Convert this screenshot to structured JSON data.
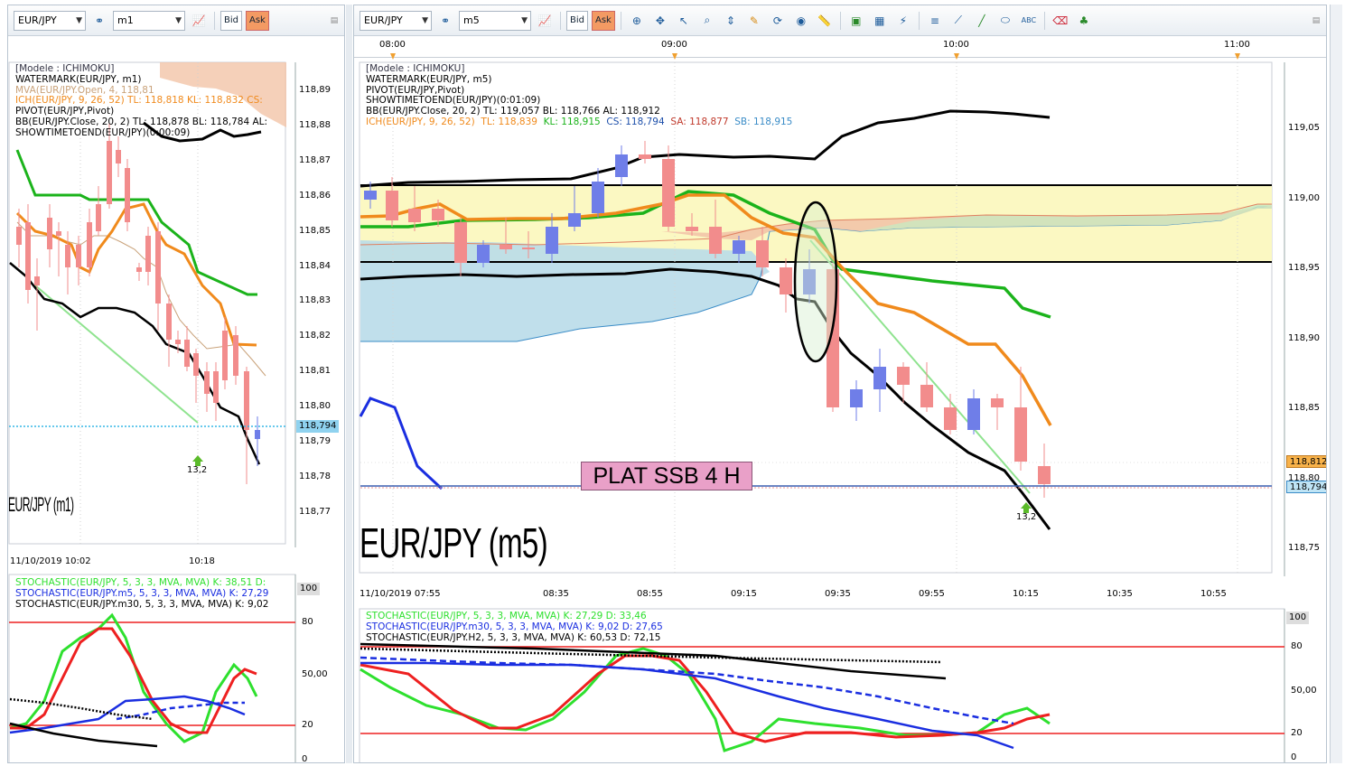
{
  "left": {
    "symbol": "EUR/JPY",
    "timeframe": "m1",
    "bid_label": "Bid",
    "ask_label": "Ask",
    "legend": [
      "[Modele : ICHIMOKU]",
      "WATERMARK(EUR/JPY, m1)",
      "MVA(EUR/JPY.Open, 4, 118,81",
      "ICH(EUR/JPY, 9, 26, 52)  TL: 118,818  KL: 118,832  CS:",
      "PIVOT(EUR/JPY,Pivot)",
      "BB(EUR/JPY.Close, 20, 2)  TL: 118,878  BL: 118,784  AL:",
      "SHOWTIMETOEND(EUR/JPY)(0:00:09)"
    ],
    "price_labels": [
      "118,89",
      "118,88",
      "118,87",
      "118,86",
      "118,85",
      "118,84",
      "118,83",
      "118,82",
      "118,81",
      "118,80",
      "118,79",
      "118,78",
      "118,77"
    ],
    "price_tag": "118,794",
    "watermark": "EUR/JPY (m1)",
    "arrow_label": "13,2",
    "time_labels": [
      "11/10/2019 10:02",
      "10:18"
    ],
    "stoch_legend": [
      "STOCHASTIC(EUR/JPY, 5, 3, 3, MVA, MVA)  K: 38,51  D:",
      "STOCHASTIC(EUR/JPY.m5, 5, 3, 3, MVA, MVA)  K: 27,29",
      "STOCHASTIC(EUR/JPY.m30, 5, 3, 3, MVA, MVA)  K: 9,02"
    ],
    "stoch_labels": [
      "100",
      "80",
      "50,00",
      "20",
      "0"
    ]
  },
  "right": {
    "symbol": "EUR/JPY",
    "timeframe": "m5",
    "bid_label": "Bid",
    "ask_label": "Ask",
    "top_times": [
      "08:00",
      "09:00",
      "10:00",
      "11:00"
    ],
    "legend": [
      "[Modele : ICHIMOKU]",
      "WATERMARK(EUR/JPY, m5)",
      "PIVOT(EUR/JPY,Pivot)",
      "SHOWTIMETOEND(EUR/JPY)(0:01:09)",
      "BB(EUR/JPY.Close, 20, 2)  TL: 119,057  BL: 118,766  AL: 118,912"
    ],
    "ich_legend": {
      "head": "ICH(EUR/JPY, 9, 26, 52)",
      "tl": "TL: 118,839",
      "kl": "KL: 118,915",
      "cs": "CS: 118,794",
      "sa": "SA: 118,877",
      "sb": "SB: 118,915"
    },
    "price_labels": [
      "119,05",
      "119,00",
      "118,95",
      "118,90",
      "118,85",
      "118,80",
      "118,75"
    ],
    "price_tag_orange": "118,812",
    "price_tag_blue": "118,794",
    "watermark": "EUR/JPY (m5)",
    "annotation": "PLAT SSB 4 H",
    "arrow_label": "13,2",
    "time_labels": [
      "11/10/2019 07:55",
      "08:35",
      "08:55",
      "09:15",
      "09:35",
      "09:55",
      "10:15",
      "10:35",
      "10:55"
    ],
    "stoch_legend": [
      "STOCHASTIC(EUR/JPY, 5, 3, 3, MVA, MVA)  K: 27,29  D: 33,46",
      "STOCHASTIC(EUR/JPY.m30, 5, 3, 3, MVA, MVA)  K: 9,02  D: 27,65",
      "STOCHASTIC(EUR/JPY.H2, 5, 3, 3, MVA, MVA)  K: 60,53  D: 72,15"
    ],
    "stoch_labels": [
      "100",
      "80",
      "50,00",
      "20",
      "0"
    ]
  },
  "colors": {
    "bull": "#6f7ee8",
    "bear": "#f28c8c",
    "tenkan": "#f08a1c",
    "kijun": "#1bb31b",
    "bb": "#000000",
    "trend": "#8fe38f",
    "kumo_bull": "#f2c4a8",
    "kumo_bear": "#b9dbe9",
    "stoch_green": "#2ee02e",
    "stoch_red": "#ee2020",
    "stoch_blue": "#1a2ee0"
  }
}
